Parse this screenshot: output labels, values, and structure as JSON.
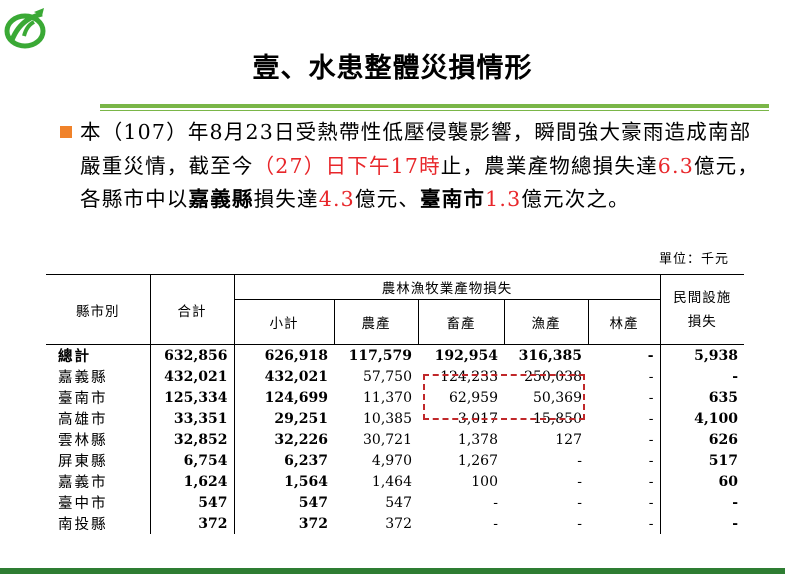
{
  "title": "壹、水患整體災損情形",
  "paragraph": {
    "s1": "本（107）年8月23日受熱帶性低壓侵襲影響，瞬間強大豪雨造成南部嚴重災情，截至今",
    "s2": "（27）日下午17時",
    "s3": "止，農業產物總損失達",
    "s4": "6.3",
    "s5": "億元，各縣市中以",
    "s6": "嘉義縣",
    "s7": "損失達",
    "s8": "4.3",
    "s9": "億元、",
    "s10": "臺南市",
    "s11": "1.3",
    "s12": "億元次之。"
  },
  "unit_label": "單位：千元",
  "table": {
    "headers": {
      "county": "縣市別",
      "total": "合計",
      "group": "農林漁牧業產物損失",
      "subtotal": "小計",
      "agri": "農產",
      "livestock": "畜產",
      "fishery": "漁產",
      "forest": "林產",
      "civil": "民間設施損失"
    },
    "rows": [
      {
        "name": "總計",
        "total": "632,856",
        "subtotal": "626,918",
        "agri": "117,579",
        "livestock": "192,954",
        "fishery": "316,385",
        "forest": "-",
        "civil": "5,938"
      },
      {
        "name": "嘉義縣",
        "total": "432,021",
        "subtotal": "432,021",
        "agri": "57,750",
        "livestock": "124,233",
        "fishery": "250,038",
        "forest": "-",
        "civil": "-"
      },
      {
        "name": "臺南市",
        "total": "125,334",
        "subtotal": "124,699",
        "agri": "11,370",
        "livestock": "62,959",
        "fishery": "50,369",
        "forest": "-",
        "civil": "635"
      },
      {
        "name": "高雄市",
        "total": "33,351",
        "subtotal": "29,251",
        "agri": "10,385",
        "livestock": "3,017",
        "fishery": "15,850",
        "forest": "-",
        "civil": "4,100"
      },
      {
        "name": "雲林縣",
        "total": "32,852",
        "subtotal": "32,226",
        "agri": "30,721",
        "livestock": "1,378",
        "fishery": "127",
        "forest": "-",
        "civil": "626"
      },
      {
        "name": "屏東縣",
        "total": "6,754",
        "subtotal": "6,237",
        "agri": "4,970",
        "livestock": "1,267",
        "fishery": "-",
        "forest": "-",
        "civil": "517"
      },
      {
        "name": "嘉義市",
        "total": "1,624",
        "subtotal": "1,564",
        "agri": "1,464",
        "livestock": "100",
        "fishery": "-",
        "forest": "-",
        "civil": "60"
      },
      {
        "name": "臺中市",
        "total": "547",
        "subtotal": "547",
        "agri": "547",
        "livestock": "-",
        "fishery": "-",
        "forest": "-",
        "civil": "-"
      },
      {
        "name": "南投縣",
        "total": "372",
        "subtotal": "372",
        "agri": "372",
        "livestock": "-",
        "fishery": "-",
        "forest": "-",
        "civil": "-"
      }
    ]
  },
  "colors": {
    "accent_green": "#7ab648",
    "bullet_orange": "#f0822a",
    "highlight_red": "#e8262a",
    "bar_green": "#2e7d32"
  }
}
